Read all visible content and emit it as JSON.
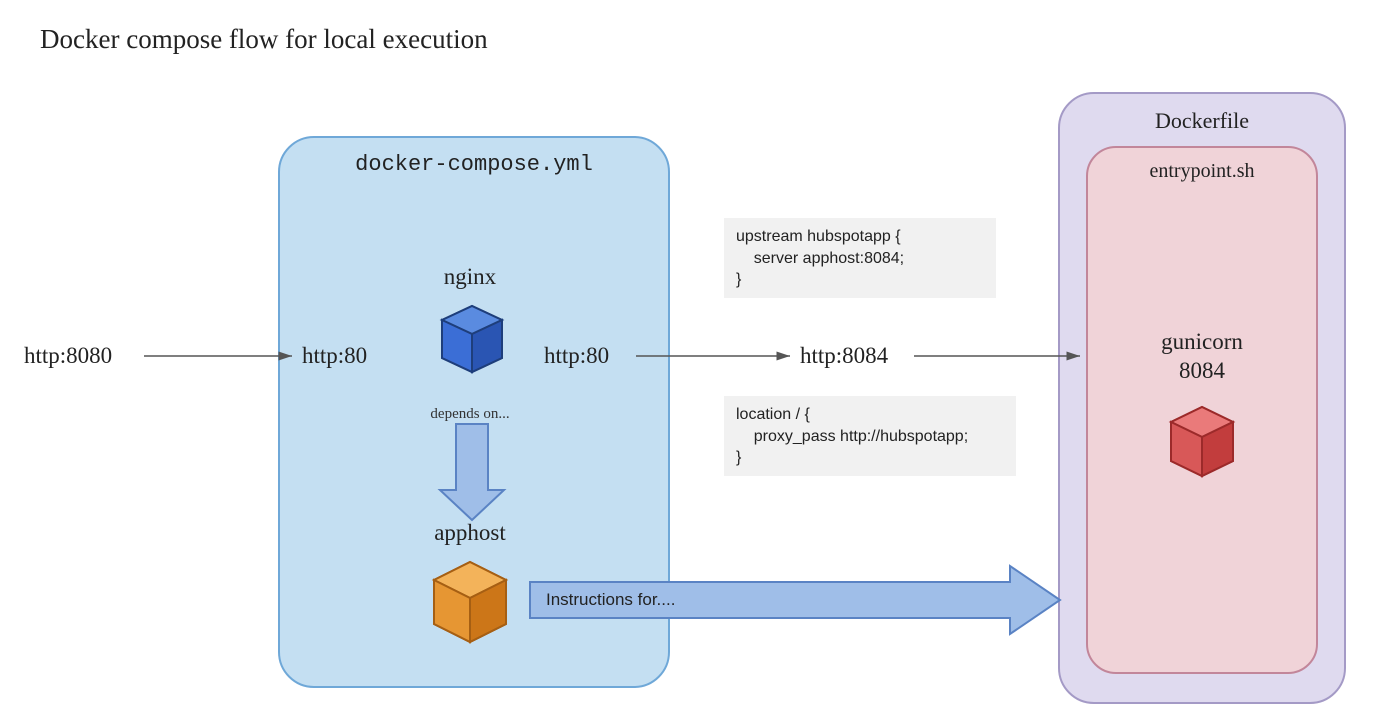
{
  "title": "Docker compose flow for local execution",
  "compose": {
    "filename": "docker-compose.yml",
    "service_nginx": "nginx",
    "depends_text": "depends on...",
    "service_apphost": "apphost"
  },
  "http": {
    "p8080": "http:8080",
    "p80_left": "http:80",
    "p80_right": "http:80",
    "p8084": "http:8084"
  },
  "nginx_conf": {
    "upstream": "upstream hubspotapp {\n    server apphost:8084;\n}",
    "location": "location / {\n    proxy_pass http://hubspotapp;\n}"
  },
  "dockerfile": {
    "title": "Dockerfile",
    "entrypoint": "entrypoint.sh",
    "gunicorn_label": "gunicorn",
    "gunicorn_port": "8084"
  },
  "big_arrow": {
    "label": "Instructions for...."
  }
}
